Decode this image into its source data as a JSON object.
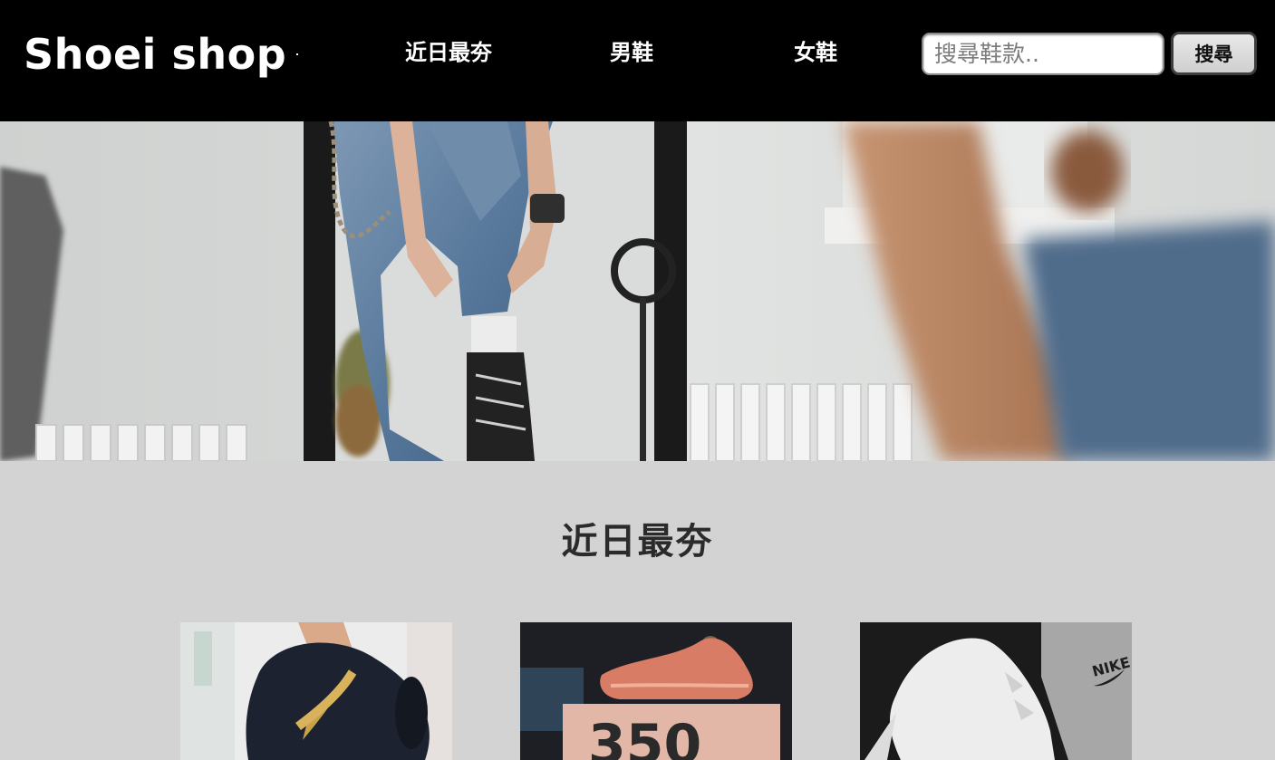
{
  "header": {
    "brand": "Shoei shop",
    "nav": [
      {
        "label": "近日最夯"
      },
      {
        "label": "男鞋"
      },
      {
        "label": "女鞋"
      }
    ],
    "search": {
      "placeholder": "搜尋鞋款..",
      "button_label": "搜尋"
    }
  },
  "hero": {
    "image": "person-tying-shoe-in-mirror-photo"
  },
  "section": {
    "title": "近日最夯"
  },
  "products": [
    {
      "image": "black-gold-sneaker-photo"
    },
    {
      "image": "pink-sneaker-on-box-photo",
      "box_text": "350"
    },
    {
      "image": "white-nike-sneakers-photo",
      "logo_text": "NIKE"
    }
  ],
  "colors": {
    "header_bg": "#000000",
    "page_bg": "#d3d3d3",
    "title_text": "#2b2b2b"
  }
}
